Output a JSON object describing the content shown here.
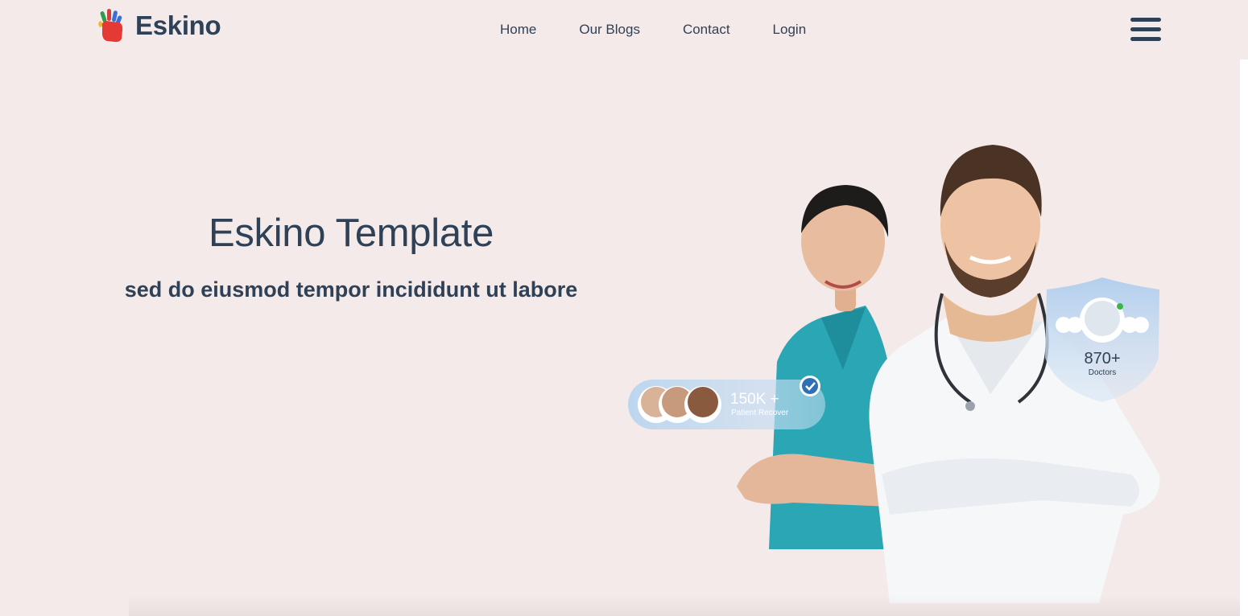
{
  "brand": {
    "name": "Eskino"
  },
  "nav": {
    "items": [
      {
        "label": "Home"
      },
      {
        "label": "Our Blogs"
      },
      {
        "label": "Contact"
      },
      {
        "label": "Login"
      }
    ]
  },
  "hero": {
    "title": "Eskino Template",
    "subtitle": "sed do eiusmod tempor incididunt ut labore",
    "badges": {
      "patients": {
        "count": "150K +",
        "label": "Patient Recover"
      },
      "doctors": {
        "count": "870+",
        "label": "Doctors"
      }
    }
  },
  "colors": {
    "background": "#f4eaea",
    "text": "#2f4157",
    "badge_blue": "#bcd6ef",
    "scrubs": "#2aa6b5"
  },
  "icons": {
    "logo": "hand-print-icon",
    "menu": "hamburger-menu-icon",
    "check": "check-circle-icon"
  }
}
